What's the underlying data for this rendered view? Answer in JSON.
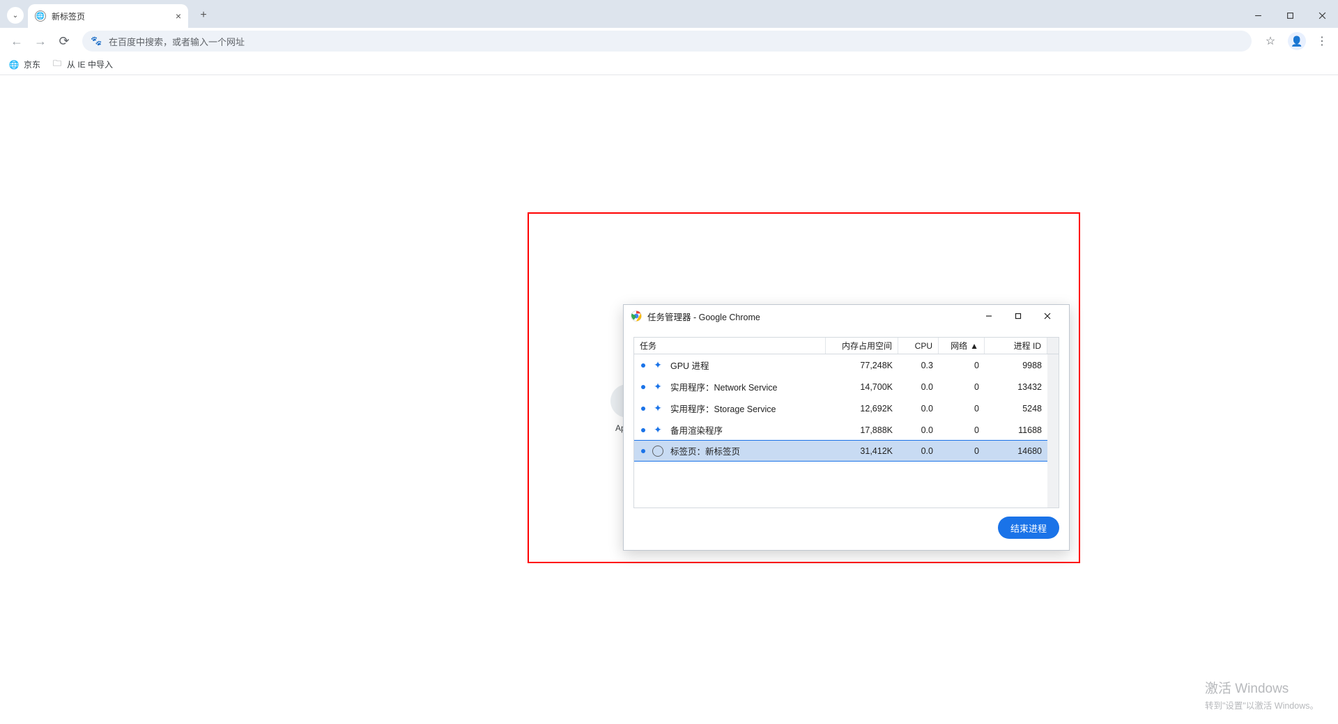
{
  "tab": {
    "title": "新标签页"
  },
  "omnibox": {
    "placeholder": "在百度中搜索，或者输入一个网址"
  },
  "bookmarks": [
    {
      "label": "京东",
      "icon": "globe"
    },
    {
      "label": "从 IE 中导入",
      "icon": "folder"
    }
  ],
  "shortcut_label": "Apach",
  "task_manager": {
    "title": "任务管理器 - Google Chrome",
    "columns": {
      "task": "任务",
      "memory": "内存占用空间",
      "cpu": "CPU",
      "network": "网络",
      "pid": "进程 ID",
      "sort_indicator": "▲"
    },
    "rows": [
      {
        "icon": "ext",
        "name": "GPU 进程",
        "memory": "77,248K",
        "cpu": "0.3",
        "network": "0",
        "pid": "9988",
        "selected": false
      },
      {
        "icon": "ext",
        "name": "实用程序：Network Service",
        "memory": "14,700K",
        "cpu": "0.0",
        "network": "0",
        "pid": "13432",
        "selected": false
      },
      {
        "icon": "ext",
        "name": "实用程序：Storage Service",
        "memory": "12,692K",
        "cpu": "0.0",
        "network": "0",
        "pid": "5248",
        "selected": false
      },
      {
        "icon": "ext",
        "name": "备用渲染程序",
        "memory": "17,888K",
        "cpu": "0.0",
        "network": "0",
        "pid": "11688",
        "selected": false
      },
      {
        "icon": "globe",
        "name": "标签页：新标签页",
        "memory": "31,412K",
        "cpu": "0.0",
        "network": "0",
        "pid": "14680",
        "selected": true
      }
    ],
    "end_process": "结束进程"
  },
  "watermark": {
    "line1": "激活 Windows",
    "line2": "转到\"设置\"以激活 Windows。"
  }
}
